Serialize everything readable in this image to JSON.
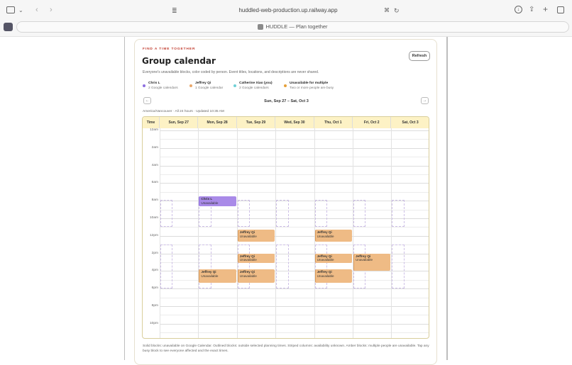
{
  "browser": {
    "url": "huddled-web-production.up.railway.app",
    "tab_title": "HUDDLE — Plan together"
  },
  "card": {
    "eyebrow": "FIND A TIME TOGETHER",
    "title": "Group calendar",
    "refresh_label": "Refresh",
    "subtitle": "Everyone's unavailable blocks, color coded by person. Event titles, locations, and descriptions are never shared.",
    "legend": [
      {
        "name": "Chris L",
        "count": "2 Google calendars",
        "color": "#8e6fe0"
      },
      {
        "name": "Jeffrey Qi",
        "count": "1 Google calendar",
        "color": "#e9a76a"
      },
      {
        "name": "Catherine Xiao (you)",
        "count": "2 Google calendars",
        "color": "#6fd0d6"
      },
      {
        "name": "Unavailable for multiple",
        "count": "Two or more people are busy",
        "color": "#e6a13a"
      }
    ],
    "range": "Sun, Sep 27 – Sat, Oct 3",
    "prev_icon": "←",
    "next_icon": "→",
    "timezone": "America/Vancouver · All 24 hours · Updated 10:35 AM",
    "footnote": "Solid blocks: unavailable on Google Calendar. Outlined blocks: outside selected planning times. Striped columns: availability unknown. Amber blocks: multiple people are unavailable. Tap any busy block to see everyone affected and the exact times."
  },
  "calendar": {
    "time_header": "Time",
    "days": [
      "Sun, Sep 27",
      "Mon, Sep 28",
      "Tue, Sep 29",
      "Wed, Sep 30",
      "Thu, Oct 1",
      "Fri, Oct 2",
      "Sat, Oct 3"
    ],
    "hour_labels": [
      "12am",
      "2am",
      "4am",
      "6am",
      "8am",
      "10am",
      "12pm",
      "2pm",
      "4pm",
      "6pm",
      "8pm",
      "10pm"
    ],
    "events": [
      {
        "day": 1,
        "start": 7.5,
        "end": 8.6,
        "person": "Chris L",
        "label": "Unavailable",
        "color": "#a98ae8",
        "border": "#8e6fe0"
      },
      {
        "day": 2,
        "start": 11.3,
        "end": 12.7,
        "person": "Jeffrey Qi",
        "label": "Unavailable",
        "color": "#efbb85",
        "border": "#d99a5a"
      },
      {
        "day": 4,
        "start": 11.3,
        "end": 12.7,
        "person": "Jeffrey Qi",
        "label": "Unavailable",
        "color": "#efbb85",
        "border": "#d99a5a"
      },
      {
        "day": 2,
        "start": 14.0,
        "end": 15.1,
        "person": "Jeffrey Qi",
        "label": "Unavailable",
        "color": "#efbb85",
        "border": "#d99a5a"
      },
      {
        "day": 4,
        "start": 14.0,
        "end": 15.1,
        "person": "Jeffrey Qi",
        "label": "Unavailable",
        "color": "#efbb85",
        "border": "#d99a5a"
      },
      {
        "day": 5,
        "start": 14.0,
        "end": 16.0,
        "person": "Jeffrey Qi",
        "label": "Unavailable",
        "color": "#efbb85",
        "border": "#d99a5a"
      },
      {
        "day": 1,
        "start": 15.8,
        "end": 17.3,
        "person": "Jeffrey Qi",
        "label": "Unavailable",
        "color": "#efbb85",
        "border": "#d99a5a"
      },
      {
        "day": 2,
        "start": 15.8,
        "end": 17.3,
        "person": "Jeffrey Qi",
        "label": "Unavailable",
        "color": "#efbb85",
        "border": "#d99a5a"
      },
      {
        "day": 4,
        "start": 15.8,
        "end": 17.3,
        "person": "Jeffrey Qi",
        "label": "Unavailable",
        "color": "#efbb85",
        "border": "#d99a5a"
      }
    ]
  }
}
